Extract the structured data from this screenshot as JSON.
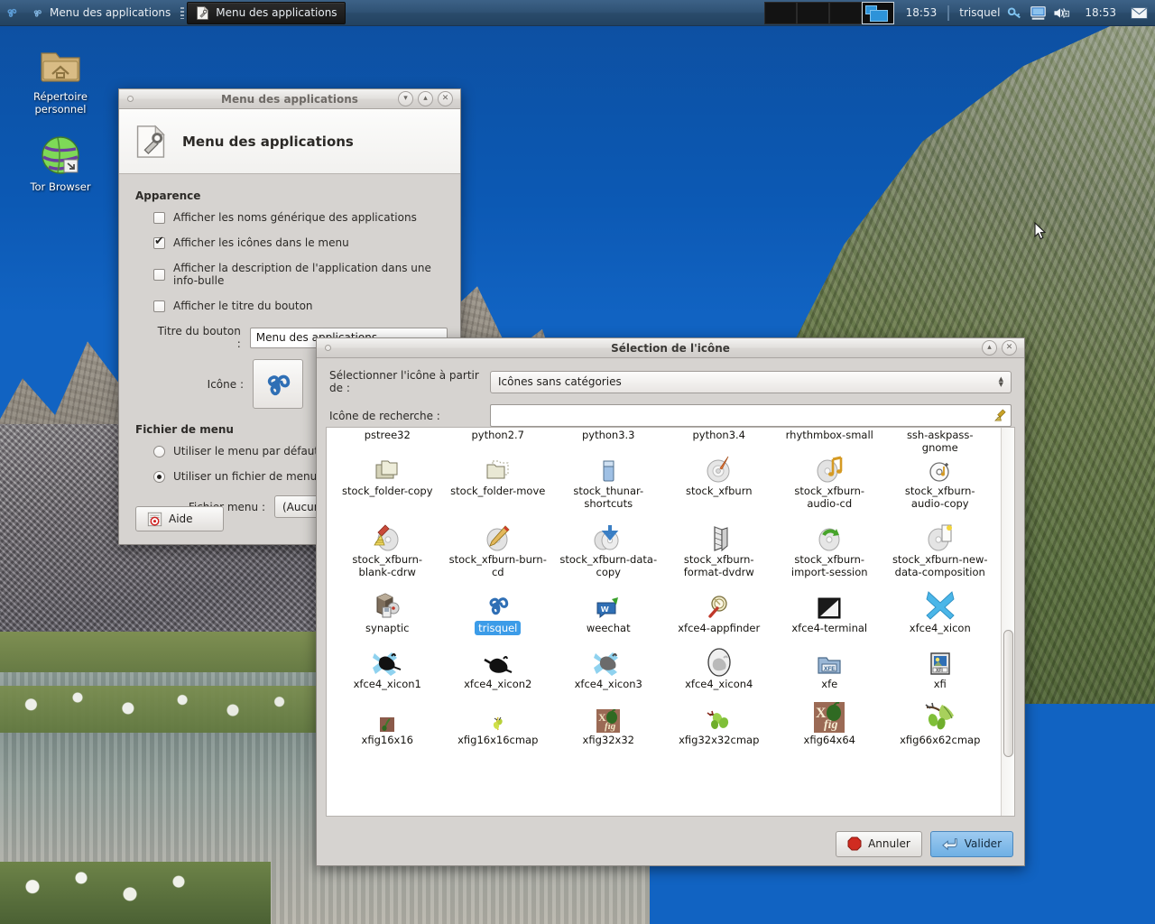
{
  "panel": {
    "launcher_icon": "triskel-icon",
    "task_buttons": [
      {
        "label": "Menu des applications",
        "icon": "triskel-icon",
        "active": false
      },
      {
        "label": "Menu des applications",
        "icon": "document-properties-icon",
        "active": true
      }
    ],
    "workspaces": [
      {
        "name": "workspace-1",
        "active": false
      },
      {
        "name": "workspace-2",
        "active": false
      },
      {
        "name": "workspace-3",
        "active": false
      },
      {
        "name": "workspace-4",
        "active": true
      }
    ],
    "clock_left": "18:53",
    "user": "trisquel",
    "tray_icons": [
      "key-icon",
      "display-icon",
      "volume-muted-icon"
    ],
    "clock_right": "18:53",
    "mail_icon": "mail-icon"
  },
  "desktop": {
    "icons": [
      {
        "label": "Répertoire personnel",
        "icon": "home-folder-icon"
      },
      {
        "label": "Tor Browser",
        "icon": "tor-browser-icon"
      }
    ]
  },
  "menu_dialog": {
    "title": "Menu des applications",
    "header_title": "Menu des applications",
    "header_icon": "document-properties-icon",
    "window_buttons": [
      "shade-icon",
      "maximize-icon",
      "close-icon"
    ],
    "appearance": {
      "group_label": "Apparence",
      "checkboxes": [
        {
          "label": "Afficher les noms générique des applications",
          "checked": false
        },
        {
          "label": "Afficher les icônes dans le menu",
          "checked": true
        },
        {
          "label": "Afficher la description de l'application dans une info-bulle",
          "checked": false
        },
        {
          "label": "Afficher le titre du bouton",
          "checked": false
        }
      ],
      "button_title_label": "Titre du bouton :",
      "button_title_value": "Menu des applications",
      "icon_label": "Icône :",
      "icon_value": "trisquel"
    },
    "menu_file": {
      "group_label": "Fichier de menu",
      "radios": [
        {
          "label": "Utiliser le menu par défaut",
          "selected": false
        },
        {
          "label": "Utiliser un fichier de menu personnalisé",
          "selected": true
        }
      ],
      "file_label": "Fichier menu :",
      "file_value": "(Aucun)"
    },
    "help_button": "Aide",
    "help_icon": "help-icon"
  },
  "icon_dialog": {
    "title": "Sélection de l'icône",
    "window_buttons": [
      "maximize-icon",
      "close-icon"
    ],
    "source_label": "Sélectionner l'icône à partir de :",
    "source_value": "Icônes sans catégories",
    "search_label": "Icône de recherche :",
    "search_value": "",
    "search_placeholder": "",
    "clear_icon": "broom-icon",
    "selected_icon": "trisquel",
    "scrollbar": {
      "thumb_top_pct": 52,
      "thumb_height_pct": 33
    },
    "rows": [
      {
        "partial": true,
        "cells": [
          {
            "name": "pstree32",
            "icon": "pstree-icon"
          },
          {
            "name": "python2.7",
            "icon": "python-icon"
          },
          {
            "name": "python3.3",
            "icon": "python-icon"
          },
          {
            "name": "python3.4",
            "icon": "python-icon"
          },
          {
            "name": "rhythmbox-small",
            "icon": "rhythmbox-icon"
          },
          {
            "name": "ssh-askpass-gnome",
            "icon": "ssh-askpass-icon"
          }
        ]
      },
      {
        "partial": false,
        "cells": [
          {
            "name": "stock_folder-copy",
            "icon": "folder-copy-icon"
          },
          {
            "name": "stock_folder-move",
            "icon": "folder-move-icon"
          },
          {
            "name": "stock_thunar-shortcuts",
            "icon": "bookmark-icon"
          },
          {
            "name": "stock_xfburn",
            "icon": "cd-pen-icon"
          },
          {
            "name": "stock_xfburn-audio-cd",
            "icon": "cd-music-icon"
          },
          {
            "name": "stock_xfburn-audio-copy",
            "icon": "cd-audio-copy-icon"
          }
        ]
      },
      {
        "partial": false,
        "cells": [
          {
            "name": "stock_xfburn-blank-cdrw",
            "icon": "cd-broom-icon"
          },
          {
            "name": "stock_xfburn-burn-cd",
            "icon": "cd-pencil-icon"
          },
          {
            "name": "stock_xfburn-data-copy",
            "icon": "cd-arrow-down-icon"
          },
          {
            "name": "stock_xfburn-format-dvdrw",
            "icon": "dvd-format-icon"
          },
          {
            "name": "stock_xfburn-import-session",
            "icon": "cd-arrow-green-icon"
          },
          {
            "name": "stock_xfburn-new-data-composition",
            "icon": "cd-page-icon"
          }
        ]
      },
      {
        "partial": false,
        "cells": [
          {
            "name": "synaptic",
            "icon": "synaptic-icon"
          },
          {
            "name": "trisquel",
            "icon": "triskel-icon",
            "selected": true
          },
          {
            "name": "weechat",
            "icon": "weechat-icon"
          },
          {
            "name": "xfce4-appfinder",
            "icon": "appfinder-icon"
          },
          {
            "name": "xfce4-terminal",
            "icon": "terminal-icon"
          },
          {
            "name": "xfce4_xicon",
            "icon": "blue-x-icon"
          }
        ]
      },
      {
        "partial": false,
        "cells": [
          {
            "name": "xfce4_xicon1",
            "icon": "mouse-x-icon"
          },
          {
            "name": "xfce4_xicon2",
            "icon": "mouse-icon"
          },
          {
            "name": "xfce4_xicon3",
            "icon": "mouse-x-grey-icon"
          },
          {
            "name": "xfce4_xicon4",
            "icon": "mouse-oval-icon"
          },
          {
            "name": "xfe",
            "icon": "xfe-folder-icon"
          },
          {
            "name": "xfi",
            "icon": "xfi-image-icon"
          }
        ]
      },
      {
        "partial": true,
        "cells": [
          {
            "name": "xfig16x16",
            "icon": "xfig-small-icon"
          },
          {
            "name": "xfig16x16cmap",
            "icon": "xfig-leaf-icon"
          },
          {
            "name": "xfig32x32",
            "icon": "xfig-logo-icon"
          },
          {
            "name": "xfig32x32cmap",
            "icon": "xfig-fig-icon"
          },
          {
            "name": "xfig64x64",
            "icon": "xfig-logo-big-icon"
          },
          {
            "name": "xfig66x62cmap",
            "icon": "xfig-branch-icon"
          }
        ]
      }
    ],
    "cancel_button": "Annuler",
    "cancel_icon": "stop-icon",
    "ok_button": "Valider",
    "ok_icon": "apply-icon"
  },
  "colors": {
    "accent": "#3c9ce8",
    "panel": "#2f5274",
    "window_bg": "#d6d3d0",
    "primary_button": "#6fb0e4"
  }
}
